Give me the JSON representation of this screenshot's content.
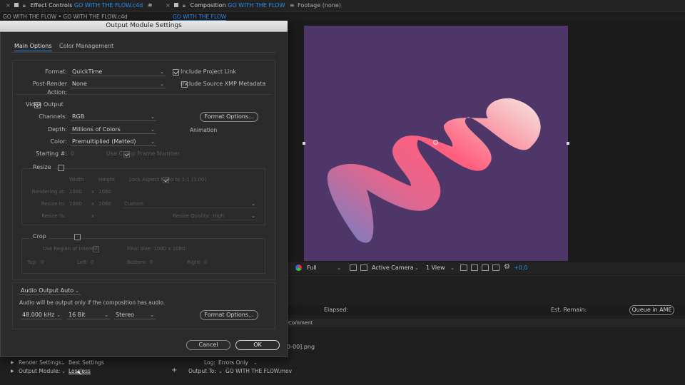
{
  "top_tabs": {
    "effect_controls_label": "Effect Controls",
    "effect_controls_target": "GO WITH THE FLOW.c4d",
    "effect_controls_path": "GO WITH THE FLOW • GO WITH THE FLOW.c4d",
    "composition_label": "Composition",
    "composition_target": "GO WITH THE FLOW",
    "composition_subtab": "GO WITH THE FLOW",
    "footage_label": "Footage (none)"
  },
  "dialog": {
    "title": "Output Module Settings",
    "tabs": [
      "Main Options",
      "Color Management"
    ],
    "format_label": "Format:",
    "format_value": "QuickTime",
    "include_project_link": "Include Project Link",
    "post_render_label": "Post-Render Action:",
    "post_render_value": "None",
    "include_xmp": "Include Source XMP Metadata",
    "video_output": "Video Output",
    "channels_label": "Channels:",
    "channels_value": "RGB",
    "format_options": "Format Options...",
    "depth_label": "Depth:",
    "depth_value": "Millions of Colors",
    "codec_text": "Animation",
    "color_label": "Color:",
    "color_value": "Premultiplied (Matted)",
    "starting_label": "Starting #:",
    "starting_value": "0",
    "use_comp_frame": "Use Comp Frame Number",
    "resize": "Resize",
    "width_hdr": "Width",
    "height_hdr": "Height",
    "lock_aspect": "Lock Aspect Ratio to 1:1 (1.00)",
    "rendering_at_label": "Rendering at:",
    "rendering_w": "1080",
    "rendering_x": "x",
    "rendering_h": "1080",
    "resize_to_label": "Resize to:",
    "resize_to_w": "1080",
    "resize_to_x": "x",
    "resize_to_h": "1080",
    "resize_to_preset": "Custom",
    "resize_pct_label": "Resize %:",
    "resize_pct_x": "x",
    "resize_quality_label": "Resize Quality:",
    "resize_quality_value": "High",
    "crop": "Crop",
    "use_roi": "Use Region of Interest",
    "final_size": "Final Size: 1080 x 1080",
    "top_label": "Top:",
    "top_value": "0",
    "left_label": "Left:",
    "left_value": "0",
    "bottom_label": "Bottom:",
    "bottom_value": "0",
    "right_label": "Right:",
    "right_value": "0",
    "audio_output": "Audio Output Auto",
    "audio_note": "Audio will be output only if the composition has audio.",
    "sample_rate": "48.000 kHz",
    "bit_depth": "16 Bit",
    "channels_audio": "Stereo",
    "audio_format_options": "Format Options...",
    "cancel": "Cancel",
    "ok": "OK"
  },
  "viewer": {
    "resolution": "Full",
    "camera": "Active Camera",
    "views": "1 View",
    "exposure": "+0.0",
    "canvas_color": "#4e3768"
  },
  "render_queue": {
    "elapsed_label": "Elapsed:",
    "est_remain_label": "Est. Remain:",
    "queue_ame": "Queue in AME",
    "comment_hdr": "Comment",
    "file_fragment": "0-00].png",
    "render_settings_label": "Render Settings:",
    "render_settings_value": "Best Settings",
    "log_label": "Log:",
    "log_value": "Errors Only",
    "output_module_label": "Output Module:",
    "output_module_value": "Lossless",
    "output_to_label": "Output To:",
    "output_to_value": "GO WITH THE FLOW.mov"
  }
}
